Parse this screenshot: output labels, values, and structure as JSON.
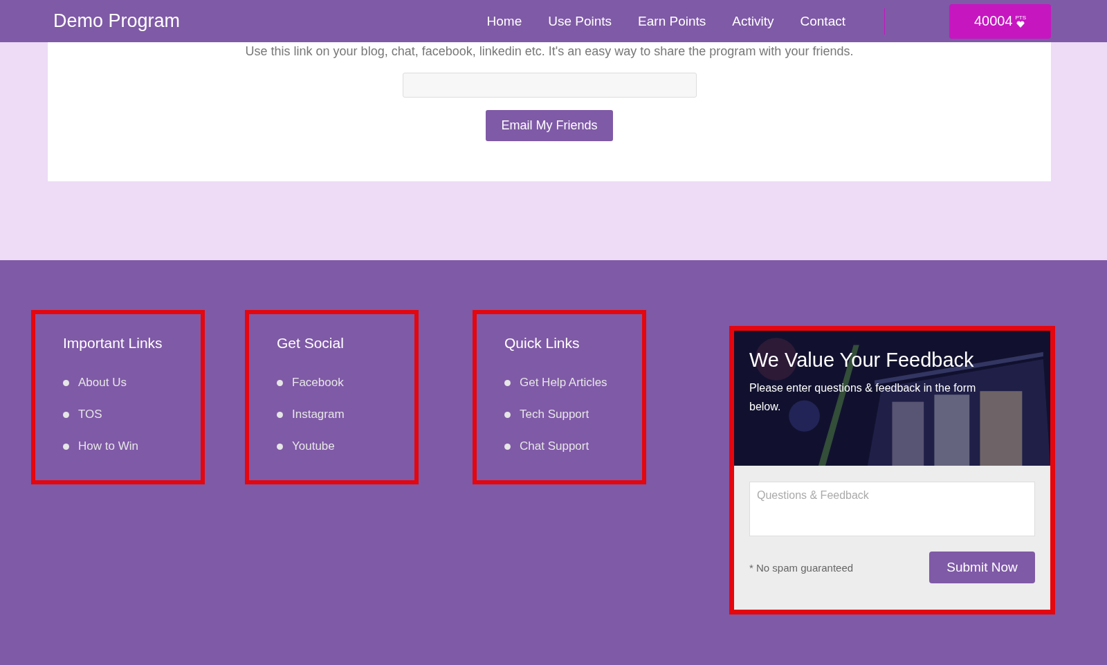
{
  "header": {
    "brand": "Demo Program",
    "nav": [
      {
        "label": "Home"
      },
      {
        "label": "Use Points"
      },
      {
        "label": "Earn Points"
      },
      {
        "label": "Activity"
      },
      {
        "label": "Contact"
      }
    ],
    "points": {
      "value": "40004",
      "unit": "PTS"
    }
  },
  "share": {
    "text": "Use this link on your blog, chat, facebook, linkedin etc. It's an easy way to share the program with your friends.",
    "button": "Email My Friends"
  },
  "footer": {
    "columns": [
      {
        "title": "Important Links",
        "highlighted": true,
        "links": [
          "About Us",
          "TOS",
          "How to Win"
        ]
      },
      {
        "title": "Get Social",
        "highlighted": true,
        "links": [
          "Facebook",
          "Instagram",
          "Youtube"
        ]
      },
      {
        "title": "Quick Links",
        "highlighted": true,
        "links": [
          "Get Help Articles",
          "Tech Support",
          "Chat Support"
        ]
      }
    ],
    "feedback": {
      "highlighted": true,
      "title": "We Value Your Feedback",
      "subtitle": "Please enter questions & feedback in the form below.",
      "placeholder": "Questions & Feedback",
      "note": "* No spam guaranteed",
      "button": "Submit Now"
    }
  }
}
